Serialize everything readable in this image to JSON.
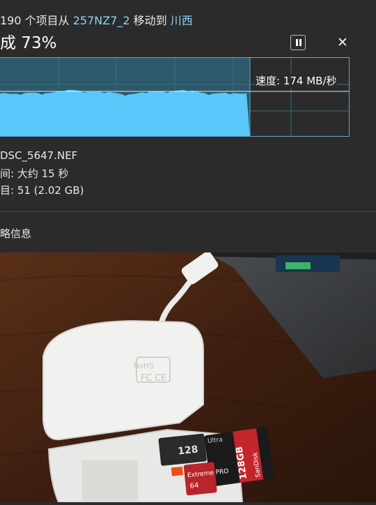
{
  "dialog": {
    "line1_prefix": "190 个项目从",
    "source": "257NZ7_2",
    "line1_mid": "移动到",
    "destination": "川西",
    "percent_text": "成 73%",
    "progress": 0.73,
    "speed_text": "速度: 174 MB/秒",
    "file_name": "DSC_5647.NEF",
    "time_left": "间: 大约 15 秒",
    "items_left": "目: 51 (2.02 GB)",
    "details_label": "略信息"
  },
  "photo": {
    "reader_labels": [
      "RoHS",
      "FC",
      "CE"
    ],
    "card_labels": [
      "128",
      "64",
      "SanDisk",
      "Extreme PRO",
      "Ultra",
      "128GB"
    ]
  },
  "colors": {
    "graph_fill": "#5ac8fa",
    "graph_bg_done": "#2d5a6a",
    "link": "#8fd0f8",
    "dialog_bg": "#2b2b2b"
  }
}
